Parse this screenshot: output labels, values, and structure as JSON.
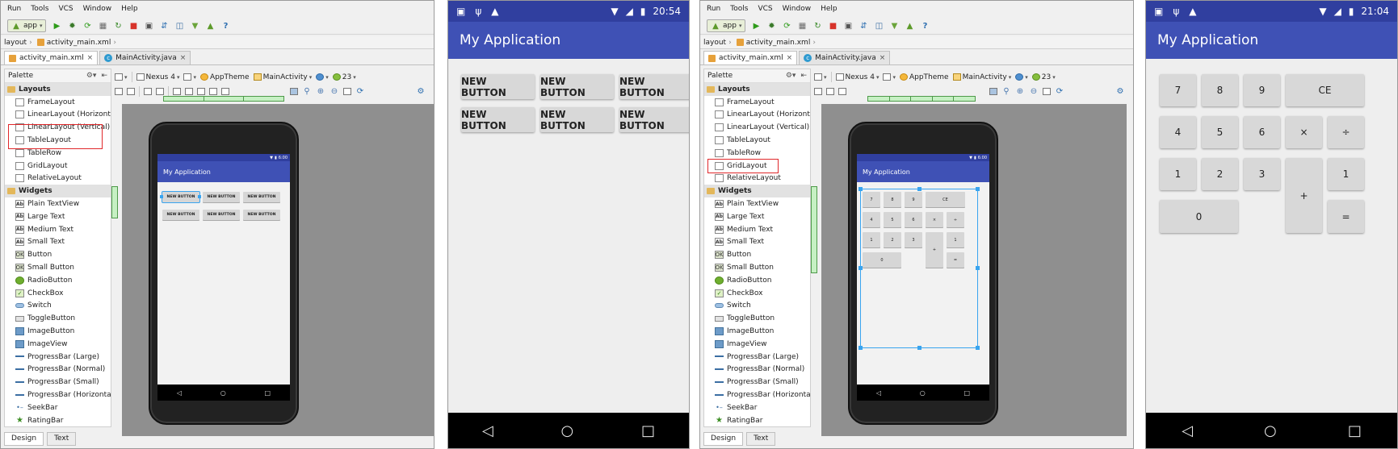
{
  "ide_menu": [
    "Run",
    "Tools",
    "VCS",
    "Window",
    "Help"
  ],
  "run_config": "app",
  "breadcrumbs": [
    "layout",
    "activity_main.xml"
  ],
  "file_tabs": [
    "activity_main.xml",
    "MainActivity.java"
  ],
  "palette_title": "Palette",
  "palette_a": [
    {
      "group": true,
      "label": "Layouts"
    },
    {
      "label": "FrameLayout"
    },
    {
      "label": "LinearLayout (Horizontal)"
    },
    {
      "label": "LinearLayout (Vertical)"
    },
    {
      "label": "TableLayout"
    },
    {
      "label": "TableRow"
    },
    {
      "label": "GridLayout"
    },
    {
      "label": "RelativeLayout"
    },
    {
      "group": true,
      "label": "Widgets"
    },
    {
      "label": "Plain TextView",
      "icon": "Ab"
    },
    {
      "label": "Large Text",
      "icon": "Ab"
    },
    {
      "label": "Medium Text",
      "icon": "Ab"
    },
    {
      "label": "Small Text",
      "icon": "Ab"
    },
    {
      "label": "Button",
      "icon": "OK"
    },
    {
      "label": "Small Button",
      "icon": "OK"
    },
    {
      "label": "RadioButton"
    },
    {
      "label": "CheckBox"
    },
    {
      "label": "Switch"
    },
    {
      "label": "ToggleButton"
    },
    {
      "label": "ImageButton"
    },
    {
      "label": "ImageView"
    },
    {
      "label": "ProgressBar (Large)"
    },
    {
      "label": "ProgressBar (Normal)"
    },
    {
      "label": "ProgressBar (Small)"
    },
    {
      "label": "ProgressBar (Horizontal)"
    },
    {
      "label": "SeekBar"
    },
    {
      "label": "RatingBar"
    }
  ],
  "palette_b": [
    {
      "group": true,
      "label": "Layouts"
    },
    {
      "label": "FrameLayout"
    },
    {
      "label": "LinearLayout (Horizontal)"
    },
    {
      "label": "LinearLayout (Vertical)"
    },
    {
      "label": "TableLayout"
    },
    {
      "label": "TableRow"
    },
    {
      "label": "GridLayout"
    },
    {
      "label": "RelativeLayout"
    },
    {
      "group": true,
      "label": "Widgets"
    },
    {
      "label": "Plain TextView",
      "icon": "Ab"
    },
    {
      "label": "Large Text",
      "icon": "Ab"
    },
    {
      "label": "Medium Text",
      "icon": "Ab"
    },
    {
      "label": "Small Text",
      "icon": "Ab"
    },
    {
      "label": "Button",
      "icon": "OK"
    },
    {
      "label": "Small Button",
      "icon": "OK"
    },
    {
      "label": "RadioButton"
    },
    {
      "label": "CheckBox"
    },
    {
      "label": "Switch"
    },
    {
      "label": "ToggleButton"
    },
    {
      "label": "ImageButton"
    },
    {
      "label": "ImageView"
    },
    {
      "label": "ProgressBar (Large)"
    },
    {
      "label": "ProgressBar (Normal)"
    },
    {
      "label": "ProgressBar (Small)"
    },
    {
      "label": "ProgressBar (Horizontal)"
    },
    {
      "label": "SeekBar"
    },
    {
      "label": "RatingBar"
    }
  ],
  "designer_toolbar": {
    "device": "Nexus 4",
    "theme": "AppTheme",
    "activity": "MainActivity",
    "api": "23"
  },
  "bottom_tabs": [
    "Design",
    "Text"
  ],
  "app_title": "My Application",
  "mini_clock": "6:00",
  "button_label": "NEW BUTTON",
  "time_a": "20:54",
  "time_b": "21:04",
  "calc_keys": [
    "7",
    "8",
    "9",
    "CE",
    "4",
    "5",
    "6",
    "×",
    "÷",
    "1",
    "2",
    "3",
    "+",
    "1",
    "0",
    "="
  ],
  "mini_calc_keys": [
    "7",
    "8",
    "9",
    "CE",
    "4",
    "5",
    "6",
    "×",
    "÷",
    "1",
    "2",
    "3",
    "+",
    "1",
    "0",
    "="
  ],
  "colors": {
    "primary": "#3f51b5",
    "primary_dark": "#303f9f",
    "highlight": "#e0282b"
  }
}
